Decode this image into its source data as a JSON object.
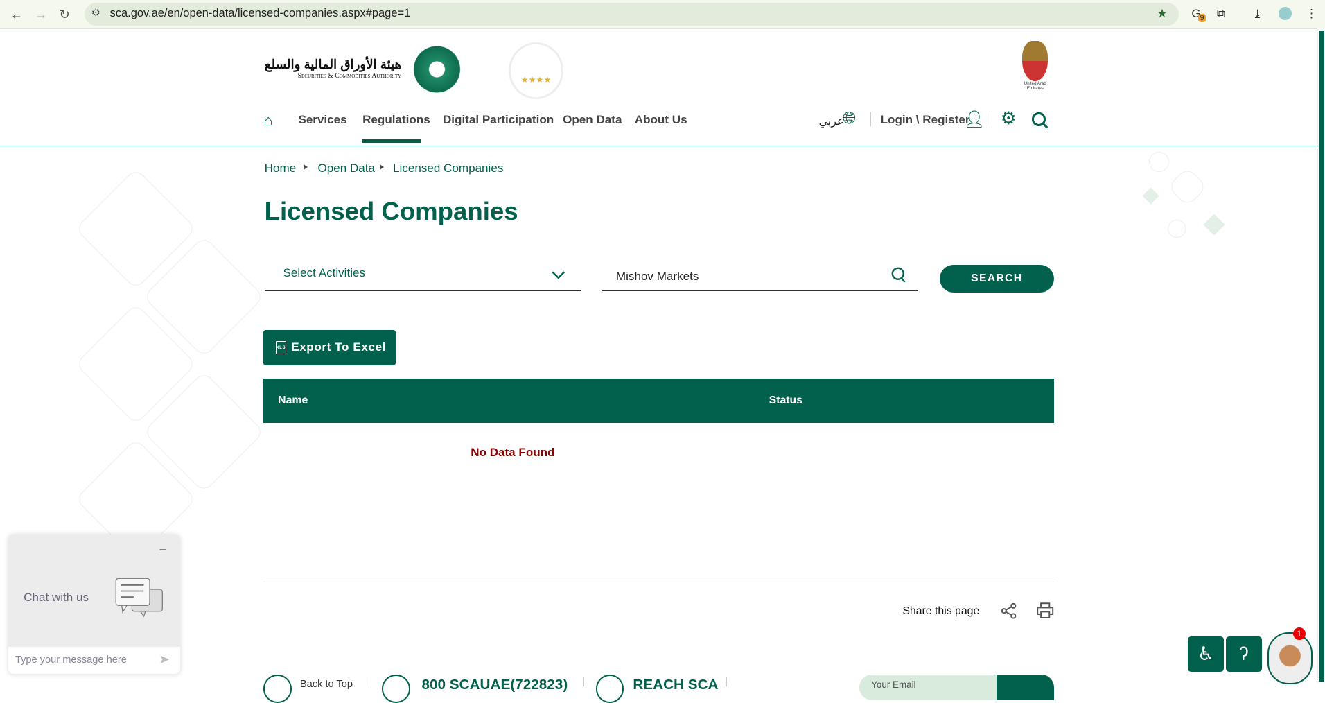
{
  "browser": {
    "url": "sca.gov.ae/en/open-data/licensed-companies.aspx#page=1",
    "ext_badge": "9"
  },
  "header": {
    "logo_arabic": "هيئة الأوراق المالية والسلع",
    "logo_english": "Securities & Commodities Authority",
    "uae_emblem_text": "United Arab Emirates"
  },
  "nav": {
    "items": [
      "Services",
      "Regulations",
      "Digital Participation",
      "Open Data",
      "About Us"
    ],
    "active": "Regulations",
    "language": "عربي",
    "login": "Login \\ Register"
  },
  "breadcrumb": [
    "Home",
    "Open Data",
    "Licensed Companies"
  ],
  "page_title": "Licensed Companies",
  "filters": {
    "activities_select": "Select Activities",
    "search_value": "Mishov Markets",
    "search_button": "SEARCH"
  },
  "export_label": "Export To Excel",
  "table": {
    "columns": [
      "Name",
      "Status"
    ],
    "empty_message": "No Data Found"
  },
  "share": {
    "label": "Share this page"
  },
  "chat": {
    "title": "Chat with us",
    "placeholder": "Type your message here",
    "minimize": "–"
  },
  "footer": {
    "back_to_top": "Back to Top",
    "phone": "800 SCAUAE(722823)",
    "reach": "REACH SCA",
    "email_placeholder": "Your Email"
  },
  "assistant_badge": "1",
  "colors": {
    "brand": "#02614c",
    "error": "#8b0000"
  }
}
